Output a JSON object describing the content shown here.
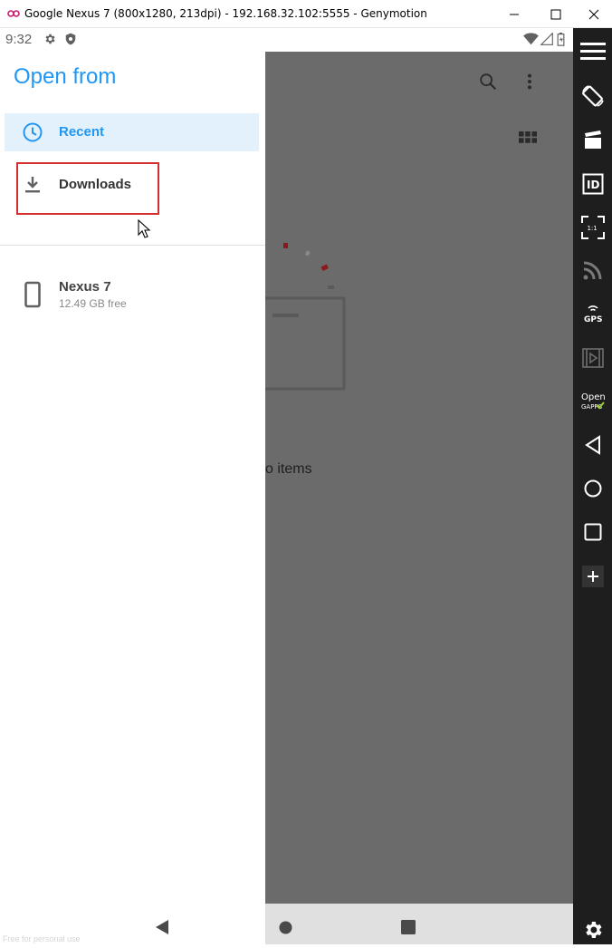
{
  "window": {
    "title": "Google Nexus 7 (800x1280, 213dpi) - 192.168.32.102:5555 - Genymotion",
    "controls": [
      "minimize",
      "maximize",
      "close"
    ]
  },
  "statusbar": {
    "time": "9:32",
    "left_icons": [
      "gear-icon",
      "shield-icon"
    ],
    "right_icons": [
      "wifi-icon",
      "signal-icon",
      "battery-icon"
    ]
  },
  "drawer": {
    "title": "Open from",
    "items": [
      {
        "label": "Recent",
        "icon": "clock-icon",
        "selected": true
      },
      {
        "label": "Downloads",
        "icon": "download-icon",
        "selected": false
      }
    ],
    "storage": {
      "label": "Nexus 7",
      "detail": "12.49 GB free",
      "icon": "phone-icon"
    }
  },
  "background_app": {
    "empty_text": "o items",
    "icons": [
      "search-icon",
      "more-vert-icon",
      "grid-view-icon"
    ]
  },
  "toolbar": {
    "buttons": [
      "menu-icon",
      "rotate-icon",
      "clapperboard-icon",
      "id-icon",
      "pixel-perfect-icon",
      "cast-icon",
      "gps-icon",
      "media-icon",
      "open-gapps-icon",
      "back-icon",
      "home-icon",
      "recents-icon",
      "add-icon",
      "settings-icon"
    ],
    "gps_label": "GPS",
    "id_label": "ID",
    "ratio_label": "1:1",
    "gapps_label_1": "Open",
    "gapps_label_2": "GAPPS"
  },
  "watermark": "Free for personal use",
  "colors": {
    "accent": "#2196f3",
    "selected_bg": "#e3f1fc",
    "highlight": "#d32f2f",
    "toolbar_bg": "#1e1e1e"
  }
}
